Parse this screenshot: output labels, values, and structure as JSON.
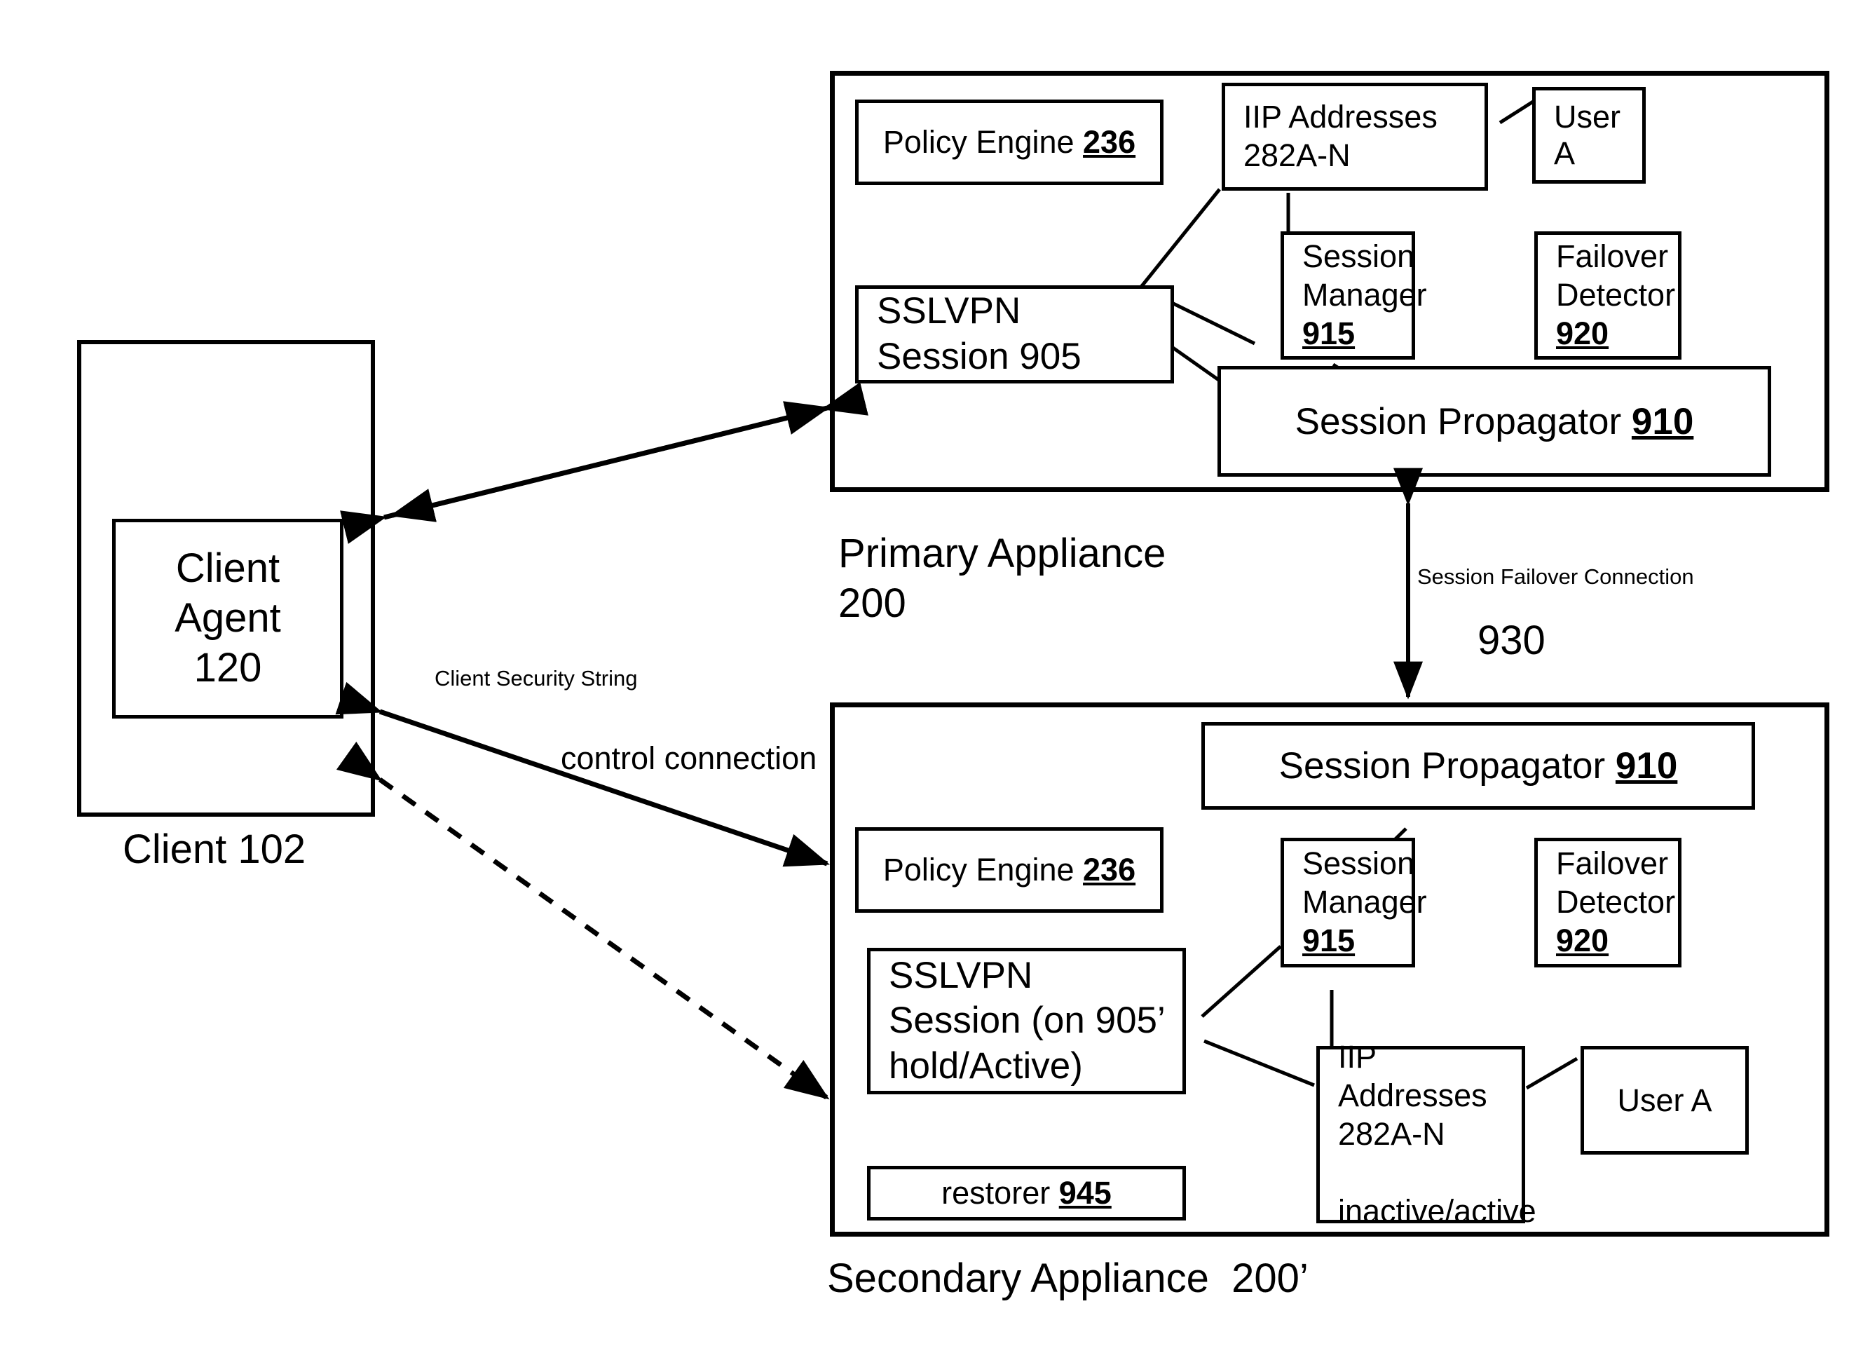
{
  "client": {
    "outer_label": "Client 102",
    "agent_label": "Client\nAgent\n120"
  },
  "primary": {
    "caption": "Primary Appliance\n200",
    "policy_engine": {
      "text": "Policy Engine ",
      "ref": "236"
    },
    "iip": {
      "text": "IIP Addresses\n282A-N"
    },
    "user": {
      "text": "User A"
    },
    "sslvpn": {
      "text": "SSLVPN\nSession 905"
    },
    "session_manager": {
      "text": "Session\nManager\n",
      "ref": "915"
    },
    "failover_detector": {
      "text": "Failover\nDetector\n",
      "ref": "920"
    },
    "session_propagator": {
      "text": "Session Propagator ",
      "ref": "910"
    }
  },
  "secondary": {
    "caption": "Secondary Appliance  200’",
    "session_propagator": {
      "text": "Session Propagator ",
      "ref": "910"
    },
    "policy_engine": {
      "text": "Policy Engine ",
      "ref": "236"
    },
    "session_manager": {
      "text": "Session\nManager\n",
      "ref": "915"
    },
    "failover_detector": {
      "text": "Failover\nDetector\n",
      "ref": "920"
    },
    "sslvpn": {
      "text": "SSLVPN\nSession  (on 905’\nhold/Active)"
    },
    "restorer": {
      "text": "restorer ",
      "ref": "945"
    },
    "iip": {
      "text": "IIP Addresses\n282A-N\n\ninactive/active"
    },
    "user": {
      "text": "User A"
    }
  },
  "connections": {
    "failover": {
      "label": "Session Failover Connection",
      "ref": "930"
    },
    "client_security_string": "Client Security String",
    "control_connection": "control connection"
  },
  "colors": {
    "stroke": "#000000",
    "background": "#ffffff"
  }
}
